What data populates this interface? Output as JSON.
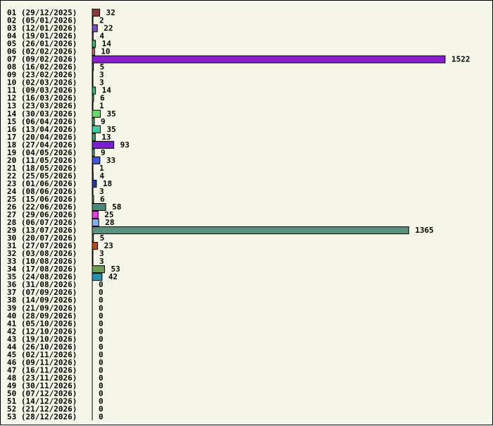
{
  "chart_data": {
    "type": "bar",
    "orientation": "horizontal",
    "categories": [
      "01 (29/12/2025)",
      "02 (05/01/2026)",
      "03 (12/01/2026)",
      "04 (19/01/2026)",
      "05 (26/01/2026)",
      "06 (02/02/2026)",
      "07 (09/02/2026)",
      "08 (16/02/2026)",
      "09 (23/02/2026)",
      "10 (02/03/2026)",
      "11 (09/03/2026)",
      "12 (16/03/2026)",
      "13 (23/03/2026)",
      "14 (30/03/2026)",
      "15 (06/04/2026)",
      "16 (13/04/2026)",
      "17 (20/04/2026)",
      "18 (27/04/2026)",
      "19 (04/05/2026)",
      "20 (11/05/2026)",
      "21 (18/05/2026)",
      "22 (25/05/2026)",
      "23 (01/06/2026)",
      "24 (08/06/2026)",
      "25 (15/06/2026)",
      "26 (22/06/2026)",
      "27 (29/06/2026)",
      "28 (06/07/2026)",
      "29 (13/07/2026)",
      "30 (20/07/2026)",
      "31 (27/07/2026)",
      "32 (03/08/2026)",
      "33 (10/08/2026)",
      "34 (17/08/2026)",
      "35 (24/08/2026)",
      "36 (31/08/2026)",
      "37 (07/09/2026)",
      "38 (14/09/2026)",
      "39 (21/09/2026)",
      "40 (28/09/2026)",
      "41 (05/10/2026)",
      "42 (12/10/2026)",
      "43 (19/10/2026)",
      "44 (26/10/2026)",
      "45 (02/11/2026)",
      "46 (09/11/2026)",
      "47 (16/11/2026)",
      "48 (23/11/2026)",
      "49 (30/11/2026)",
      "50 (07/12/2026)",
      "51 (14/12/2026)",
      "52 (21/12/2026)",
      "53 (28/12/2026)"
    ],
    "values": [
      32,
      2,
      22,
      4,
      14,
      10,
      1522,
      5,
      3,
      3,
      14,
      6,
      1,
      35,
      9,
      35,
      13,
      93,
      9,
      33,
      1,
      4,
      18,
      3,
      6,
      58,
      25,
      28,
      1365,
      5,
      23,
      3,
      3,
      53,
      42,
      0,
      0,
      0,
      0,
      0,
      0,
      0,
      0,
      0,
      0,
      0,
      0,
      0,
      0,
      0,
      0,
      0,
      0
    ],
    "value_labels": [
      "32",
      "2",
      "22",
      "4",
      "14",
      "10",
      "1522",
      "5",
      "3",
      "3",
      "14",
      "6",
      "1",
      "35",
      "9",
      "35",
      "13",
      "93",
      "9",
      "33",
      "1",
      "4",
      "18",
      "3",
      "6",
      "58",
      "25",
      "28",
      "1365",
      "5",
      "23",
      "3",
      "3",
      "53",
      "42",
      "0",
      "0",
      "0",
      "0",
      "0",
      "0",
      "0",
      "0",
      "0",
      "0",
      "0",
      "0",
      "0",
      "0",
      "0",
      "0",
      "0",
      "0"
    ],
    "colors": [
      "#8b3a3a",
      "#5a4a8a",
      "#7b4fbf",
      "#4a9a7a",
      "#3cb371",
      "#cd6a6a",
      "#8a1fd0",
      "#4a5ab0",
      "#4a9a7a",
      "#4a9a7a",
      "#3cb371",
      "#4a9a7a",
      "#4a9a7a",
      "#66dd66",
      "#4a9a7a",
      "#3cd0a0",
      "#3ca070",
      "#7b1fcf",
      "#4a9a7a",
      "#4455dd",
      "#4a9a7a",
      "#4a9a7a",
      "#2a3aa0",
      "#4a9a7a",
      "#4a9a7a",
      "#4a8a7a",
      "#dd44dd",
      "#88aaee",
      "#5a9080",
      "#4a9a7a",
      "#b84a1a",
      "#4a9a7a",
      "#4a9a7a",
      "#6aa050",
      "#2a90b0",
      "#4a9a7a",
      "#4a9a7a",
      "#4a9a7a",
      "#4a9a7a",
      "#4a9a7a",
      "#4a9a7a",
      "#4a9a7a",
      "#4a9a7a",
      "#4a9a7a",
      "#4a9a7a",
      "#4a9a7a",
      "#4a9a7a",
      "#4a9a7a",
      "#4a9a7a",
      "#4a9a7a",
      "#4a9a7a",
      "#4a9a7a",
      "#4a9a7a"
    ],
    "xlim": [
      0,
      1522
    ],
    "grid": false,
    "legend": "none"
  }
}
